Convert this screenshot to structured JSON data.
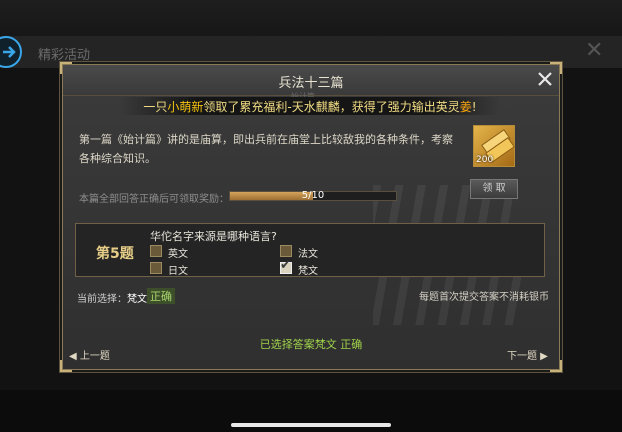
{
  "background": {
    "title": "精彩活动"
  },
  "dialog": {
    "title": "兵法十三篇",
    "subtitle": "始计篇",
    "banner": {
      "prefix": "一只",
      "user": "小萌新",
      "middle": "领取了累充福利-天水麒麟，获得了强力输出英灵",
      "hero": "姜",
      "suffix": "!"
    },
    "description": "第一篇《始计篇》讲的是庙算，即出兵前在庙堂上比较敌我的各种条件，考察各种综合知识。",
    "reward": {
      "count": "200",
      "icon": "gold-bar-icon",
      "claim_label": "领 取"
    },
    "progress": {
      "label": "本篇全部回答正确后可领取奖励：",
      "text": "5/10",
      "current": 5,
      "total": 10
    },
    "quiz": {
      "number": "第5题",
      "question": "华佗名字来源是哪种语言?",
      "options": [
        {
          "label": "英文",
          "checked": false
        },
        {
          "label": "法文",
          "checked": false
        },
        {
          "label": "日文",
          "checked": false
        },
        {
          "label": "梵文",
          "checked": true
        }
      ]
    },
    "current": {
      "label": "当前选择：",
      "value": "梵文",
      "status": "正确"
    },
    "note": "每题首次提交答案不消耗银币",
    "result": "已选择答案梵文 正确",
    "nav": {
      "prev": "上一题",
      "next": "下一题"
    }
  },
  "colors": {
    "accent_gold": "#e6ce88",
    "correct_green": "#9fd24a",
    "banner_yellow": "#f4c20f"
  }
}
